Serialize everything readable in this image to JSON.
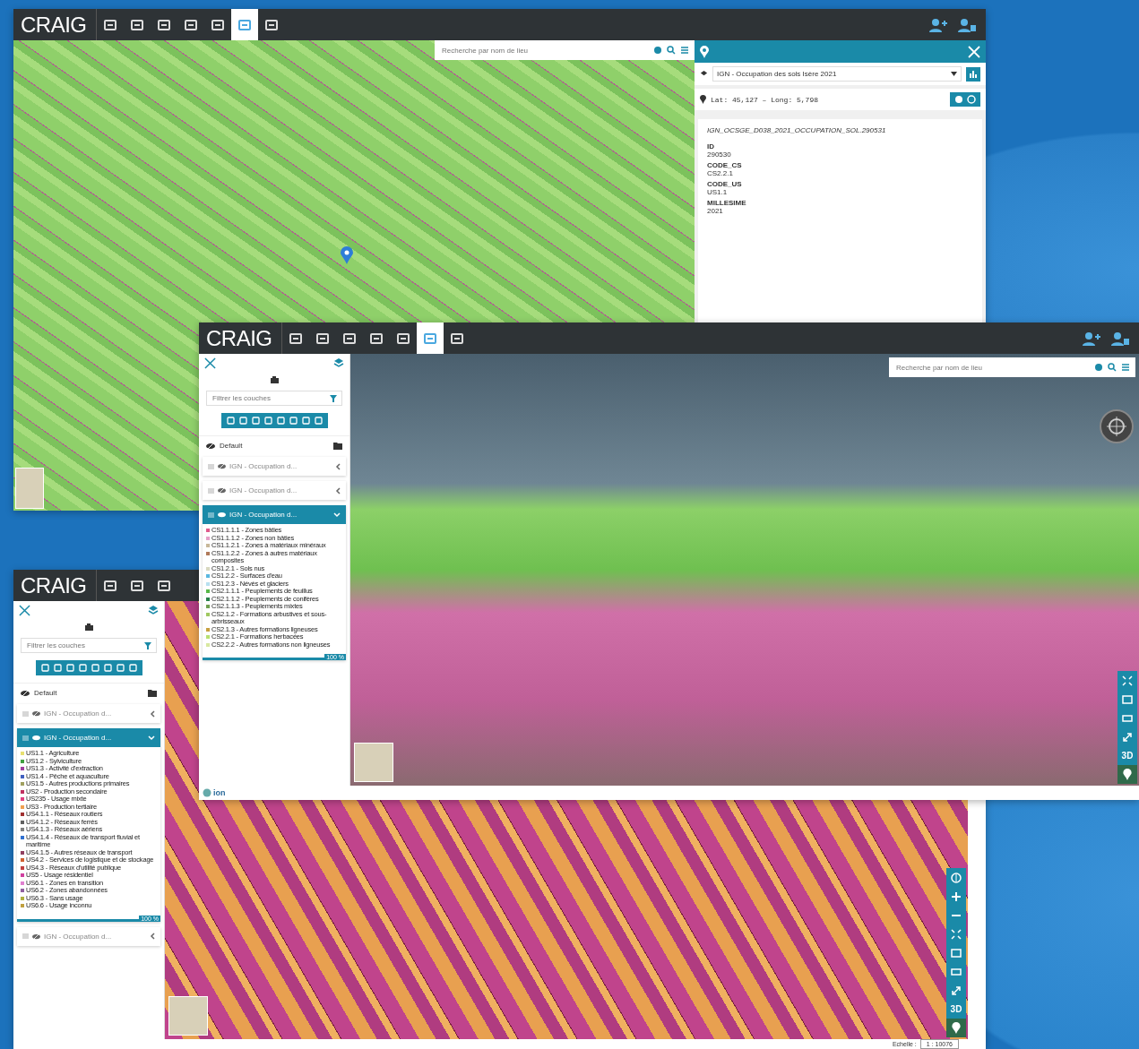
{
  "attribute_window": {
    "logo": "CRAIG",
    "toolbar": [
      {
        "selected": false
      },
      {
        "selected": false
      },
      {
        "selected": false
      },
      {
        "selected": false
      },
      {
        "selected": false
      },
      {
        "selected": true
      },
      {
        "selected": false
      }
    ],
    "search": {
      "placeholder": "Recherche par nom de lieu"
    },
    "panel": {
      "layer_select": "IGN - Occupation des sols Isère 2021",
      "coordinates": "Lat: 45,127 – Long: 5,798",
      "feature_id": "IGN_OCSGE_D038_2021_OCCUPATION_SOL.290531",
      "fields": [
        {
          "name": "ID",
          "value": "290530"
        },
        {
          "name": "CODE_CS",
          "value": "CS2.2.1"
        },
        {
          "name": "CODE_US",
          "value": "US1.1"
        },
        {
          "name": "MILLESIME",
          "value": "2021"
        }
      ]
    }
  },
  "layer_windows": [
    {
      "kind": "globe",
      "logo": "CRAIG",
      "toolbar": [
        {
          "selected": false
        },
        {
          "selected": false
        },
        {
          "selected": false
        },
        {
          "selected": false
        },
        {
          "selected": false
        },
        {
          "selected": true
        },
        {
          "selected": false
        }
      ],
      "search": {
        "placeholder": "Recherche par nom de lieu"
      },
      "filter": {
        "placeholder": "Filtrer les couches"
      },
      "group": "Default",
      "layers": [
        {
          "name": "IGN - Occupation d...",
          "expanded": false
        },
        {
          "name": "IGN - Occupation d...",
          "expanded": false
        },
        {
          "name": "IGN - Occupation d...",
          "expanded": true,
          "opacity": "100 %",
          "legend": [
            {
              "label": "CS1.1.1.1 - Zones bâties",
              "color": "#e05a8c"
            },
            {
              "label": "CS1.1.1.2 - Zones non bâties",
              "color": "#e6a0c8"
            },
            {
              "label": "CS1.1.2.1 - Zones à matériaux minéraux",
              "color": "#c8b89a"
            },
            {
              "label": "CS1.1.2.2 - Zones à autres matériaux composites",
              "color": "#b07a5a"
            },
            {
              "label": "CS1.2.1 - Sols nus",
              "color": "#d8d8c0"
            },
            {
              "label": "CS1.2.2 - Surfaces d'eau",
              "color": "#5ab8e0"
            },
            {
              "label": "CS1.2.3 - Névés et glaciers",
              "color": "#b8e0f0"
            },
            {
              "label": "CS2.1.1.1 - Peuplements de feuillus",
              "color": "#58b848"
            },
            {
              "label": "CS2.1.1.2 - Peuplements de conifères",
              "color": "#28804a"
            },
            {
              "label": "CS2.1.1.3 - Peuplements mixtes",
              "color": "#70a050"
            },
            {
              "label": "CS2.1.2 - Formations arbustives et sous-arbrisseaux",
              "color": "#a0c860"
            },
            {
              "label": "CS2.1.3 - Autres formations ligneuses",
              "color": "#c8a040"
            },
            {
              "label": "CS2.2.1 - Formations herbacées",
              "color": "#b8e070"
            },
            {
              "label": "CS2.2.2 - Autres formations non ligneuses",
              "color": "#d8e8a0"
            }
          ]
        }
      ],
      "controls": [
        {
          "kind": "fit"
        },
        {
          "kind": "frame"
        },
        {
          "kind": "screen"
        },
        {
          "kind": "expand"
        },
        {
          "kind": "text",
          "label": "3D"
        },
        {
          "kind": "pin"
        }
      ],
      "attribution": "ion"
    },
    {
      "kind": "plan",
      "logo": "CRAIG",
      "toolbar": [
        {
          "selected": false
        },
        {
          "selected": false
        },
        {
          "selected": false
        }
      ],
      "filter": {
        "placeholder": "Filtrer les couches"
      },
      "group": "Default",
      "layers": [
        {
          "name": "IGN - Occupation d...",
          "expanded": false
        },
        {
          "name": "IGN - Occupation d...",
          "expanded": true,
          "opacity": "100 %",
          "legend": [
            {
              "label": "US1.1 - Agriculture",
              "color": "#e8e070"
            },
            {
              "label": "US1.2 - Sylviculture",
              "color": "#40a040"
            },
            {
              "label": "US1.3 - Activité d'extraction",
              "color": "#a040a0"
            },
            {
              "label": "US1.4 - Pêche et aquaculture",
              "color": "#4060c0"
            },
            {
              "label": "US1.5 - Autres productions primaires",
              "color": "#a0a060"
            },
            {
              "label": "US2 - Production secondaire",
              "color": "#c03060"
            },
            {
              "label": "US235 - Usage mixte",
              "color": "#e04080"
            },
            {
              "label": "US3 - Production tertiaire",
              "color": "#f0a050"
            },
            {
              "label": "US4.1.1 - Réseaux routiers",
              "color": "#a03030"
            },
            {
              "label": "US4.1.2 - Réseaux ferrés",
              "color": "#606060"
            },
            {
              "label": "US4.1.3 - Réseaux aériens",
              "color": "#808080"
            },
            {
              "label": "US4.1.4 - Réseaux de transport fluvial et maritime",
              "color": "#3070d0"
            },
            {
              "label": "US4.1.5 - Autres réseaux de transport",
              "color": "#904060"
            },
            {
              "label": "US4.2 - Services de logistique et de stockage",
              "color": "#d06030"
            },
            {
              "label": "US4.3 - Réseaux d'utilité publique",
              "color": "#c04040"
            },
            {
              "label": "US5 - Usage résidentiel",
              "color": "#d040a0"
            },
            {
              "label": "US6.1 - Zones en transition",
              "color": "#e080d0"
            },
            {
              "label": "US6.2 - Zones abandonnées",
              "color": "#9060a0"
            },
            {
              "label": "US6.3 - Sans usage",
              "color": "#b0b040"
            },
            {
              "label": "US6.6 - Usage inconnu",
              "color": "#c0a040"
            }
          ]
        },
        {
          "name": "IGN - Occupation d...",
          "expanded": false
        }
      ],
      "controls": [
        {
          "kind": "compass"
        },
        {
          "kind": "zoom-in"
        },
        {
          "kind": "zoom-out"
        },
        {
          "kind": "fit"
        },
        {
          "kind": "frame"
        },
        {
          "kind": "screen"
        },
        {
          "kind": "expand"
        },
        {
          "kind": "text",
          "label": "3D"
        },
        {
          "kind": "pin"
        }
      ],
      "status": {
        "scale_label": "Echelle :",
        "scale": "1 : 10076"
      }
    }
  ]
}
